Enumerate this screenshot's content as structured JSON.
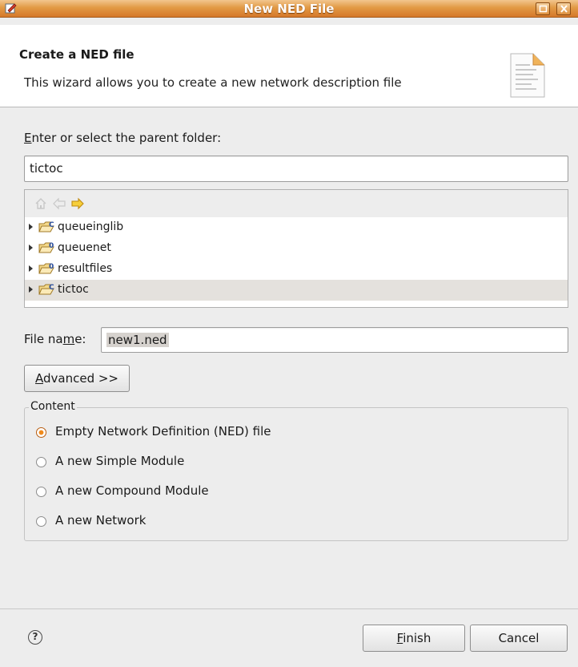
{
  "window": {
    "title": "New NED File",
    "accent": "#e29a45"
  },
  "header": {
    "title": "Create a NED file",
    "description": "This wizard allows you to create a new network description file"
  },
  "folder": {
    "label_prefix": "E",
    "label_rest": "nter or select the parent folder:",
    "value": "tictoc",
    "toolbar_icons": [
      "home-icon",
      "back-arrow-icon",
      "forward-arrow-icon"
    ],
    "items": [
      {
        "label": "queueinglib",
        "icon": "c-project-folder-icon",
        "badge": "C",
        "selected": false
      },
      {
        "label": "queuenet",
        "icon": "o-project-folder-icon",
        "badge": "0",
        "selected": false
      },
      {
        "label": "resultfiles",
        "icon": "o-project-folder-icon",
        "badge": "0",
        "selected": false
      },
      {
        "label": "tictoc",
        "icon": "c-project-folder-icon",
        "badge": "C",
        "selected": true
      }
    ]
  },
  "file": {
    "label_pre": "File na",
    "label_u": "m",
    "label_post": "e:",
    "value": "new1.ned"
  },
  "advanced_button": {
    "u": "A",
    "rest": "dvanced >>"
  },
  "content": {
    "legend": "Content",
    "options": [
      {
        "label": "Empty Network Definition (NED) file",
        "checked": true
      },
      {
        "label": "A new Simple Module",
        "checked": false
      },
      {
        "label": "A new Compound Module",
        "checked": false
      },
      {
        "label": "A new Network",
        "checked": false
      }
    ]
  },
  "footer": {
    "help_icon": "help-icon",
    "help_glyph": "?",
    "finish_u": "F",
    "finish_rest": "inish",
    "cancel_label": "Cancel"
  }
}
